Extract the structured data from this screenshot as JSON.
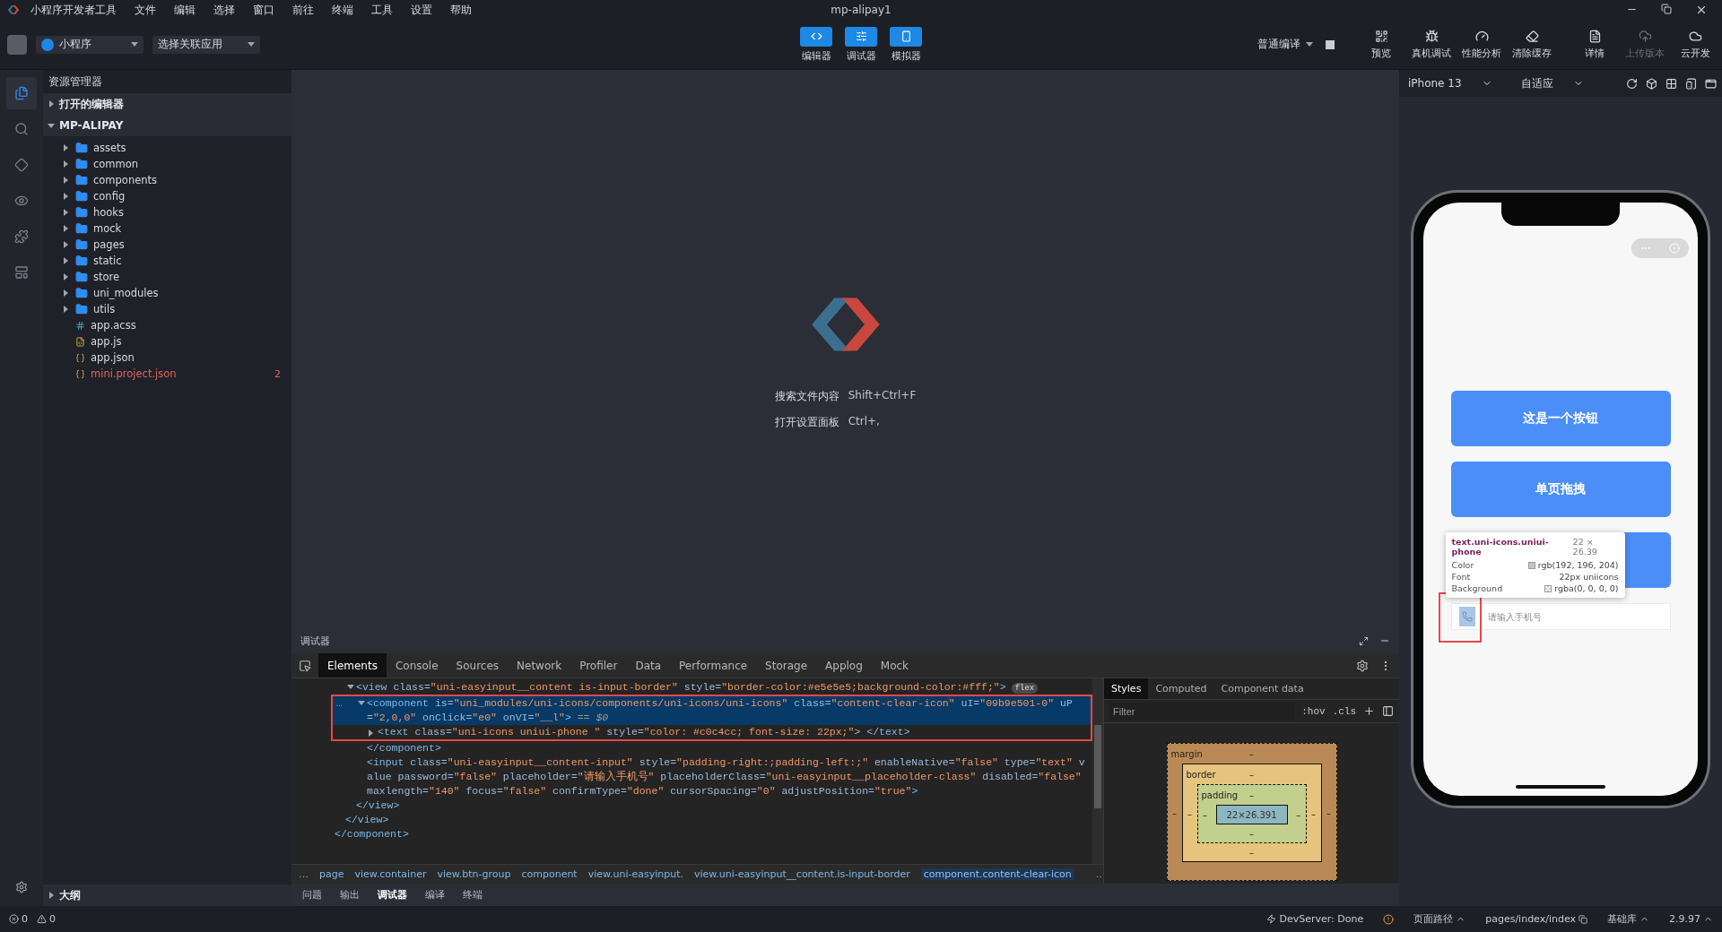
{
  "title_bar": {
    "app_name": "小程序开发者工具",
    "menus": [
      "文件",
      "编辑",
      "选择",
      "窗口",
      "前往",
      "终端",
      "工具",
      "设置",
      "帮助"
    ],
    "title": "mp-alipay1"
  },
  "toolbar": {
    "app_type": {
      "label": "小程序"
    },
    "related_app": {
      "label": "选择关联应用"
    },
    "modes": [
      {
        "kind": "editor",
        "label": "编辑器",
        "on": true
      },
      {
        "kind": "debugger",
        "label": "调试器",
        "on": true
      },
      {
        "kind": "simulator",
        "label": "模拟器",
        "on": true
      }
    ],
    "compile_mode": {
      "label": "普通编译"
    },
    "actions": [
      {
        "kind": "preview",
        "label": "预览",
        "disabled": false
      },
      {
        "kind": "device",
        "label": "真机调试",
        "disabled": false
      },
      {
        "kind": "perf",
        "label": "性能分析",
        "disabled": false
      },
      {
        "kind": "clear",
        "label": "清除缓存",
        "disabled": false
      },
      {
        "kind": "details",
        "label": "详情",
        "disabled": false
      },
      {
        "kind": "upload",
        "label": "上传版本",
        "disabled": true
      },
      {
        "kind": "cloud",
        "label": "云开发",
        "disabled": false
      }
    ]
  },
  "activity_bar": [
    {
      "kind": "explorer",
      "selected": true
    },
    {
      "kind": "search",
      "selected": false
    },
    {
      "kind": "git",
      "selected": false
    },
    {
      "kind": "watch",
      "selected": false
    },
    {
      "kind": "extensions",
      "selected": false
    },
    {
      "kind": "templates",
      "selected": false
    }
  ],
  "explorer": {
    "title": "资源管理器",
    "sections": [
      {
        "label": "打开的编辑器",
        "expanded": false
      },
      {
        "label": "MP-ALIPAY",
        "expanded": true,
        "children": [
          {
            "name": "assets",
            "kind": "folder",
            "expanded": false
          },
          {
            "name": "common",
            "kind": "folder",
            "expanded": false
          },
          {
            "name": "components",
            "kind": "folder",
            "expanded": false
          },
          {
            "name": "config",
            "kind": "folder",
            "expanded": false
          },
          {
            "name": "hooks",
            "kind": "folder",
            "expanded": false
          },
          {
            "name": "mock",
            "kind": "folder",
            "expanded": false
          },
          {
            "name": "pages",
            "kind": "folder",
            "expanded": false
          },
          {
            "name": "static",
            "kind": "folder",
            "expanded": false
          },
          {
            "name": "store",
            "kind": "folder",
            "expanded": false
          },
          {
            "name": "uni_modules",
            "kind": "folder",
            "expanded": false
          },
          {
            "name": "utils",
            "kind": "folder",
            "expanded": false
          },
          {
            "name": "app.acss",
            "kind": "style"
          },
          {
            "name": "app.js",
            "kind": "script"
          },
          {
            "name": "app.json",
            "kind": "json"
          },
          {
            "name": "mini.project.json",
            "kind": "json",
            "problems": "2"
          }
        ]
      }
    ],
    "outline": {
      "label": "大纲",
      "expanded": false
    }
  },
  "editor_welcome": {
    "shortcuts": [
      {
        "label": "搜索文件内容",
        "keys": "Shift+Ctrl+F"
      },
      {
        "label": "打开设置面板",
        "keys": "Ctrl+,"
      }
    ]
  },
  "debugger": {
    "title": "调试器",
    "tabs": [
      {
        "label": "Elements",
        "selected": true
      },
      {
        "label": "Console",
        "selected": false
      },
      {
        "label": "Sources",
        "selected": false
      },
      {
        "label": "Network",
        "selected": false
      },
      {
        "label": "Profiler",
        "selected": false
      },
      {
        "label": "Data",
        "selected": false
      },
      {
        "label": "Performance",
        "selected": false
      },
      {
        "label": "Storage",
        "selected": false
      },
      {
        "label": "Applog",
        "selected": false
      },
      {
        "label": "Mock",
        "selected": false
      }
    ],
    "elements_tree": [
      {
        "close": "</component>",
        "children": [
          {
            "close": "</view>",
            "children": [
              {
                "open": [
                  {
                    "kind": "tag",
                    "text": "<view"
                  },
                  {
                    "kind": "attr",
                    "text": " class="
                  },
                  {
                    "kind": "val",
                    "text": "\"uni-easyinput__content is-input-border\""
                  },
                  {
                    "kind": "attr",
                    "text": " style="
                  },
                  {
                    "kind": "val",
                    "text": "\"border-color:#e5e5e5;background-color:#fff;\""
                  },
                  {
                    "kind": "tag",
                    "text": ">"
                  }
                ],
                "badge": "flex",
                "selected": false,
                "expanded": true,
                "close": "</view>",
                "children": [
                  {
                    "open": [
                      {
                        "kind": "tag",
                        "text": "<component"
                      },
                      {
                        "kind": "attr",
                        "text": " is="
                      },
                      {
                        "kind": "val",
                        "text": "\"uni_modules/uni-icons/components/uni-icons/uni-icons\""
                      },
                      {
                        "kind": "attr",
                        "text": " class="
                      },
                      {
                        "kind": "val",
                        "text": "\"content-clear-icon\""
                      },
                      {
                        "kind": "attr",
                        "text": " uI="
                      },
                      {
                        "kind": "val",
                        "text": "\"09b9e501-0\""
                      },
                      {
                        "kind": "attr",
                        "text": " uP="
                      },
                      {
                        "kind": "val",
                        "text": "\"2,0,0\""
                      },
                      {
                        "kind": "attr",
                        "text": " onClick="
                      },
                      {
                        "kind": "val",
                        "text": "\"e0\""
                      },
                      {
                        "kind": "attr",
                        "text": " onVI="
                      },
                      {
                        "kind": "val",
                        "text": "\"__l\""
                      },
                      {
                        "kind": "tag",
                        "text": ">"
                      },
                      {
                        "kind": "ref",
                        "text": " == $0"
                      }
                    ],
                    "gutter": "…",
                    "selected": true,
                    "annotated": true,
                    "expanded": true,
                    "close": "</component>",
                    "children": [
                      {
                        "open": [
                          {
                            "kind": "tag",
                            "text": "<text"
                          },
                          {
                            "kind": "attr",
                            "text": " class="
                          },
                          {
                            "kind": "val",
                            "text": "\"uni-icons uniui-phone \""
                          },
                          {
                            "kind": "attr",
                            "text": " style="
                          },
                          {
                            "kind": "val",
                            "text": "\"color: #c0c4cc; font-size: 22px;\""
                          },
                          {
                            "kind": "tag",
                            "text": "> </text>"
                          }
                        ],
                        "selected": false,
                        "expanded": false
                      }
                    ]
                  },
                  {
                    "open": [
                      {
                        "kind": "tag",
                        "text": "<input"
                      },
                      {
                        "kind": "attr",
                        "text": " class="
                      },
                      {
                        "kind": "val",
                        "text": "\"uni-easyinput__content-input\""
                      },
                      {
                        "kind": "attr",
                        "text": " style="
                      },
                      {
                        "kind": "val",
                        "text": "\"padding-right:;padding-left:;\""
                      },
                      {
                        "kind": "attr",
                        "text": " enableNative="
                      },
                      {
                        "kind": "val",
                        "text": "\"false\""
                      },
                      {
                        "kind": "attr",
                        "text": " type="
                      },
                      {
                        "kind": "val",
                        "text": "\"text\""
                      },
                      {
                        "kind": "attr",
                        "text": " value password="
                      },
                      {
                        "kind": "val",
                        "text": "\"false\""
                      },
                      {
                        "kind": "attr",
                        "text": " placeholder="
                      },
                      {
                        "kind": "val",
                        "text": "\"请输入手机号\""
                      },
                      {
                        "kind": "attr",
                        "text": " placeholderClass="
                      },
                      {
                        "kind": "val",
                        "text": "\"uni-easyinput__placeholder-class\""
                      },
                      {
                        "kind": "attr",
                        "text": " disabled="
                      },
                      {
                        "kind": "val",
                        "text": "\"false\""
                      },
                      {
                        "kind": "attr",
                        "text": " maxlength="
                      },
                      {
                        "kind": "val",
                        "text": "\"140\""
                      },
                      {
                        "kind": "attr",
                        "text": " focus="
                      },
                      {
                        "kind": "val",
                        "text": "\"false\""
                      },
                      {
                        "kind": "attr",
                        "text": " confirmType="
                      },
                      {
                        "kind": "val",
                        "text": "\"done\""
                      },
                      {
                        "kind": "attr",
                        "text": " cursorSpacing="
                      },
                      {
                        "kind": "val",
                        "text": "\"0\""
                      },
                      {
                        "kind": "attr",
                        "text": " adjustPosition="
                      },
                      {
                        "kind": "val",
                        "text": "\"true\""
                      },
                      {
                        "kind": "tag",
                        "text": ">"
                      }
                    ],
                    "selected": false
                  }
                ]
              }
            ]
          }
        ]
      }
    ],
    "breadcrumb": {
      "more_left": "…",
      "more_right": "…",
      "items": [
        {
          "label": "page",
          "selected": false
        },
        {
          "label": "view.container",
          "selected": false
        },
        {
          "label": "view.btn-group",
          "selected": false
        },
        {
          "label": "component",
          "selected": false
        },
        {
          "label": "view.uni-easyinput.",
          "selected": false
        },
        {
          "label": "view.uni-easyinput__content.is-input-border",
          "selected": false
        },
        {
          "label": "component.content-clear-icon",
          "selected": true
        }
      ]
    },
    "styles_tabs": [
      {
        "label": "Styles",
        "selected": true
      },
      {
        "label": "Computed",
        "selected": false
      },
      {
        "label": "Component data",
        "selected": false
      }
    ],
    "filter": {
      "placeholder": "Filter"
    },
    "filter_buttons": [
      ":hov",
      ".cls"
    ],
    "box_model": {
      "kind": "margin",
      "label": "margin",
      "top": "–",
      "left": "–",
      "inner": {
        "kind": "border",
        "label": "border",
        "top": "–",
        "left": "–",
        "inner": {
          "kind": "padding",
          "label": "padding",
          "top": "–",
          "left": "–",
          "content": "22×26.391",
          "right": "–",
          "bottom": "–"
        },
        "right": "–",
        "bottom": "–"
      },
      "right": "–"
    },
    "bottom_tabs": [
      {
        "label": "问题",
        "selected": false
      },
      {
        "label": "输出",
        "selected": false
      },
      {
        "label": "调试器",
        "selected": true
      },
      {
        "label": "编译",
        "selected": false
      },
      {
        "label": "终端",
        "selected": false
      }
    ]
  },
  "simulator": {
    "device": "iPhone 13",
    "zoom": "自适应",
    "buttons": [
      "这是一个按钮",
      "单页拖拽"
    ],
    "input": {
      "placeholder": "请输入手机号",
      "icon_annotated": true
    },
    "inspect_tooltip": {
      "selector": "text.uni-icons.uniui-phone",
      "size": "22 × 26.39",
      "rows": [
        {
          "label": "Color",
          "value": "rgb(192, 196, 204)",
          "kind": "color"
        },
        {
          "label": "Font",
          "value": "22px uniicons",
          "kind": "font"
        },
        {
          "label": "Background",
          "value": "rgba(0, 0, 0, 0)",
          "kind": "transparent"
        }
      ]
    }
  },
  "status_bar": {
    "errors": "0",
    "warnings": "0",
    "server": "DevServer: Done",
    "page_path_label": "页面路径",
    "page_path": "pages/index/index",
    "lib_label": "基础库",
    "lib_version": "2.9.97"
  }
}
